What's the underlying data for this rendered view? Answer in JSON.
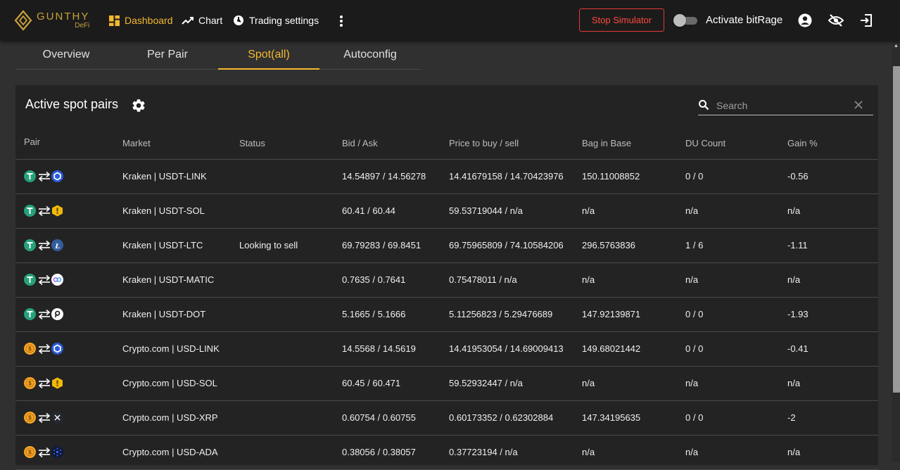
{
  "header": {
    "logo_main": "GUNTHY",
    "logo_sub": "DeFi",
    "nav": [
      {
        "label": "Dashboard",
        "icon": "dashboard-icon"
      },
      {
        "label": "Chart",
        "icon": "trending-up-icon"
      },
      {
        "label": "Trading settings",
        "icon": "settings-cycle-icon"
      }
    ],
    "stop_button": "Stop Simulator",
    "toggle_label": "Activate bitRage",
    "toggle_on": false
  },
  "tabs": [
    {
      "label": "Overview",
      "active": false
    },
    {
      "label": "Per Pair",
      "active": false
    },
    {
      "label": "Spot(all)",
      "active": true
    },
    {
      "label": "Autoconfig",
      "active": false
    }
  ],
  "card": {
    "title": "Active spot pairs",
    "search_placeholder": "Search"
  },
  "table": {
    "columns": [
      "Pair",
      "Market",
      "Status",
      "Bid / Ask",
      "Price to buy / sell",
      "Bag in Base",
      "DU Count",
      "Gain %"
    ],
    "rows": [
      {
        "base": "usdt",
        "quote": "link",
        "market": "Kraken | USDT-LINK",
        "status": "",
        "bidask": "14.54897 / 14.56278",
        "price": "14.41679158 / 14.70423976",
        "bag": "150.11008852",
        "du": "0 / 0",
        "gain": "-0.56"
      },
      {
        "base": "usdt",
        "quote": "sol",
        "market": "Kraken | USDT-SOL",
        "status": "",
        "bidask": "60.41 / 60.44",
        "price": "59.53719044 / n/a",
        "bag": "n/a",
        "du": "n/a",
        "gain": "n/a"
      },
      {
        "base": "usdt",
        "quote": "ltc",
        "market": "Kraken | USDT-LTC",
        "status": "Looking to sell",
        "bidask": "69.79283 / 69.8451",
        "price": "69.75965809 / 74.10584206",
        "bag": "296.5763836",
        "du": "1 / 6",
        "gain": "-1.11"
      },
      {
        "base": "usdt",
        "quote": "matic",
        "market": "Kraken | USDT-MATIC",
        "status": "",
        "bidask": "0.7635 / 0.7641",
        "price": "0.75478011 / n/a",
        "bag": "n/a",
        "du": "n/a",
        "gain": "n/a"
      },
      {
        "base": "usdt",
        "quote": "dot",
        "market": "Kraken | USDT-DOT",
        "status": "",
        "bidask": "5.1665 / 5.1666",
        "price": "5.11256823 / 5.29476689",
        "bag": "147.92139871",
        "du": "0 / 0",
        "gain": "-1.93"
      },
      {
        "base": "usd",
        "quote": "link",
        "market": "Crypto.com | USD-LINK",
        "status": "",
        "bidask": "14.5568 / 14.5619",
        "price": "14.41953054 / 14.69009413",
        "bag": "149.68021442",
        "du": "0 / 0",
        "gain": "-0.41"
      },
      {
        "base": "usd",
        "quote": "sol",
        "market": "Crypto.com | USD-SOL",
        "status": "",
        "bidask": "60.45 / 60.471",
        "price": "59.52932447 / n/a",
        "bag": "n/a",
        "du": "n/a",
        "gain": "n/a"
      },
      {
        "base": "usd",
        "quote": "xrp",
        "market": "Crypto.com | USD-XRP",
        "status": "",
        "bidask": "0.60754 / 0.60755",
        "price": "0.60173352 / 0.62302884",
        "bag": "147.34195635",
        "du": "0 / 0",
        "gain": "-2"
      },
      {
        "base": "usd",
        "quote": "ada",
        "market": "Crypto.com | USD-ADA",
        "status": "",
        "bidask": "0.38056 / 0.38057",
        "price": "0.37723194 / n/a",
        "bag": "n/a",
        "du": "n/a",
        "gain": "n/a"
      }
    ]
  },
  "colors": {
    "accent": "#f5b82e",
    "danger": "#e53935",
    "usdt": "#26a17b",
    "usd": "#f5a623",
    "link": "#2a5ada",
    "sol": "#f0b90b",
    "ltc": "#345d9d",
    "matic": "#ffffff",
    "dot": "#ffffff",
    "xrp": "#23292f",
    "ada": "#0033ad"
  }
}
